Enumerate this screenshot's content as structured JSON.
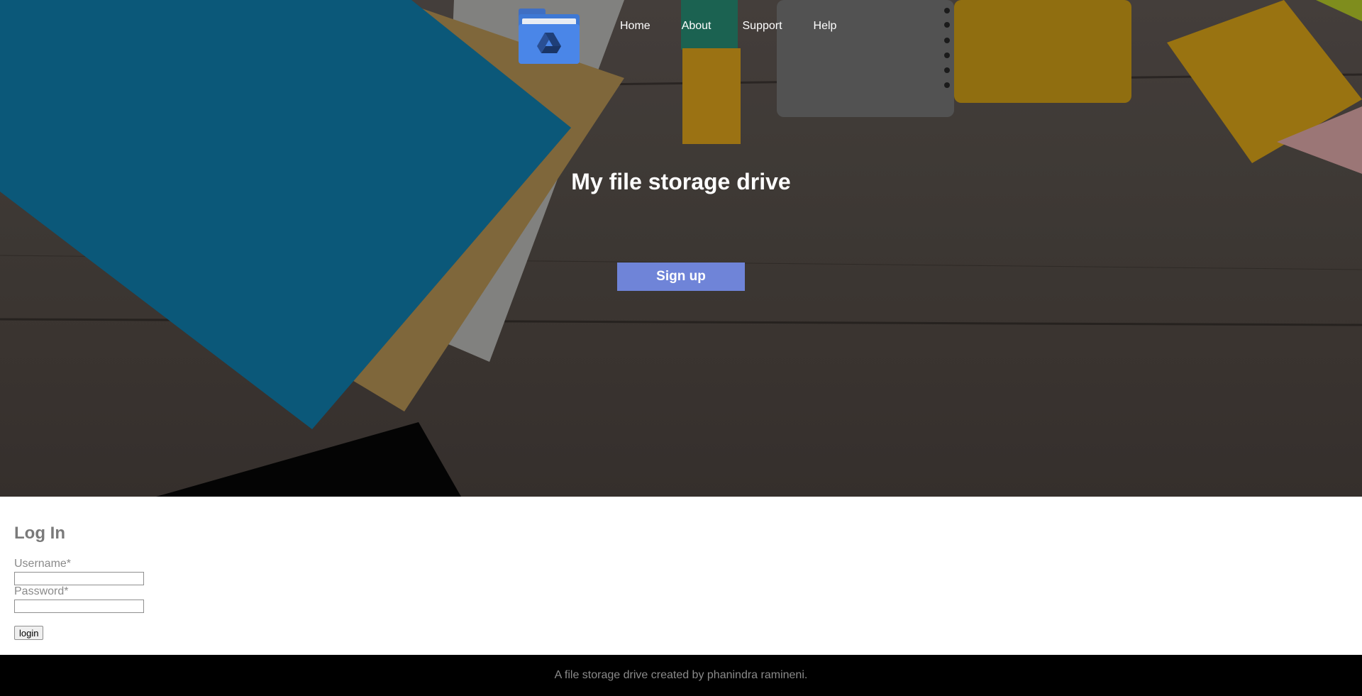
{
  "nav": {
    "logo_icon": "drive-folder-icon",
    "links": [
      "Home",
      "About",
      "Support",
      "Help"
    ]
  },
  "hero": {
    "title": "My file storage drive",
    "signup_label": "Sign up"
  },
  "login": {
    "title": "Log In",
    "username_label": "Username*",
    "password_label": "Password*",
    "username_value": "",
    "password_value": "",
    "submit_label": "login"
  },
  "footer": {
    "text": "A file storage drive created by phanindra ramineni."
  },
  "colors": {
    "signup_button": "#6f84d8",
    "folder_blue": "#4a86e8",
    "footer_bg": "#000000"
  }
}
